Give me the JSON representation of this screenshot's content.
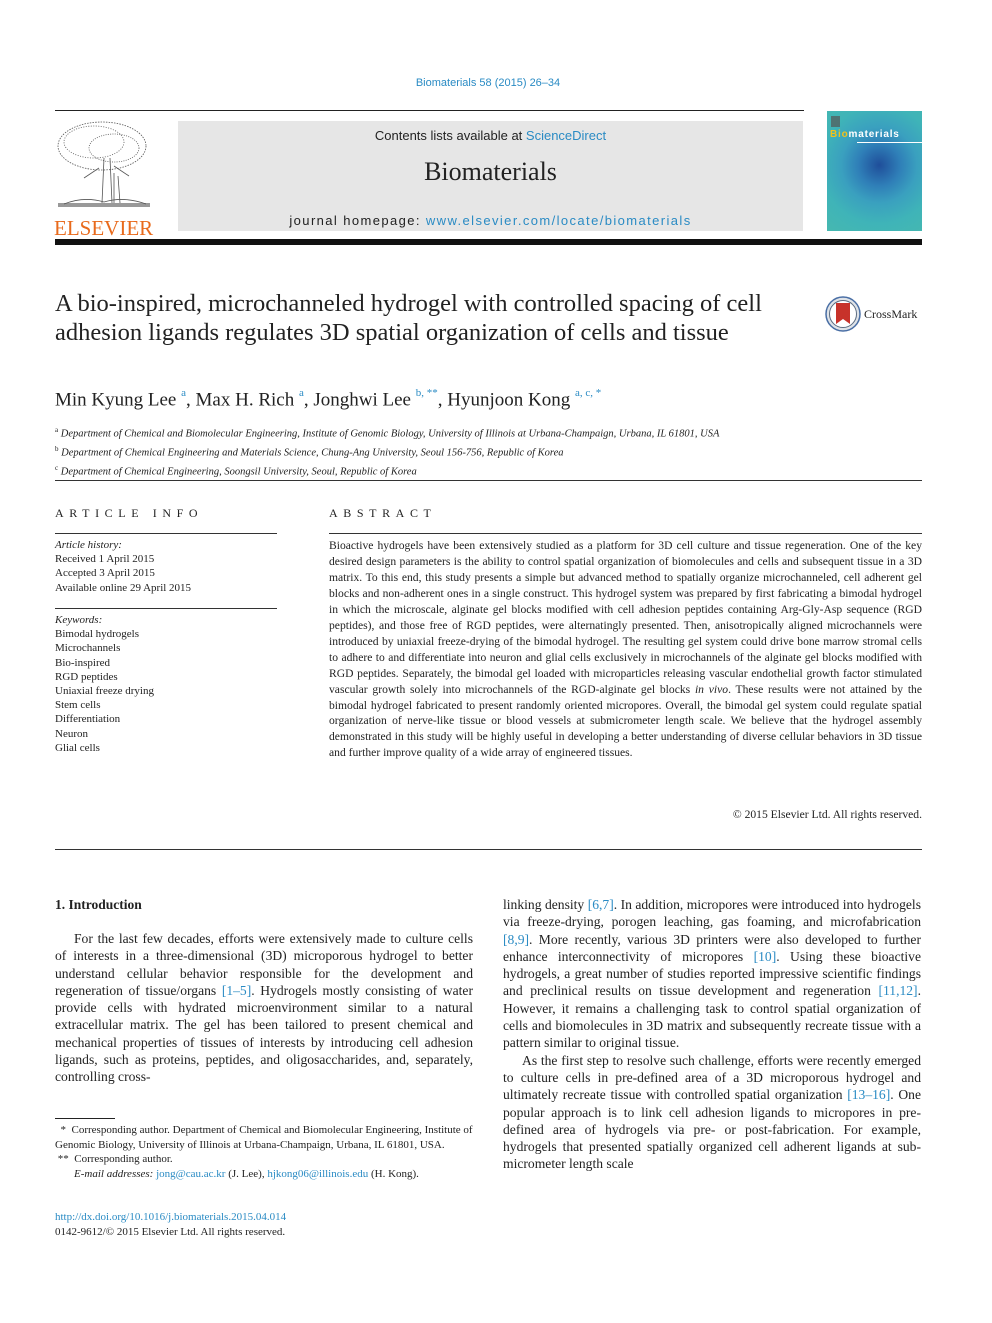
{
  "header": {
    "journal_ref": "Biomaterials 58 (2015) 26–34",
    "contents_prefix": "Contents lists available at ",
    "contents_link": "ScienceDirect",
    "journal_name": "Biomaterials",
    "homepage_prefix": "journal homepage: ",
    "homepage_link": "www.elsevier.com/locate/biomaterials",
    "publisher_logo_text": "ELSEVIER",
    "cover_title_bio": "Bio",
    "cover_title_rest": "materials",
    "crossmark_label": "CrossMark",
    "colors": {
      "link": "#2a8bc4",
      "elsevier_orange": "#e86a1c",
      "masthead_bg": "#e6e6e6"
    }
  },
  "article": {
    "title": "A bio-inspired, microchanneled hydrogel with controlled spacing of cell adhesion ligands regulates 3D spatial organization of cells and tissue",
    "authors": [
      {
        "name": "Min Kyung Lee",
        "sup": "a"
      },
      {
        "name": "Max H. Rich",
        "sup": "a"
      },
      {
        "name": "Jonghwi Lee",
        "sup": "b, **"
      },
      {
        "name": "Hyunjoon Kong",
        "sup": "a, c, *"
      }
    ],
    "affiliations": [
      {
        "mark": "a",
        "text": "Department of Chemical and Biomolecular Engineering, Institute of Genomic Biology, University of Illinois at Urbana-Champaign, Urbana, IL 61801, USA"
      },
      {
        "mark": "b",
        "text": "Department of Chemical Engineering and Materials Science, Chung-Ang University, Seoul 156-756, Republic of Korea"
      },
      {
        "mark": "c",
        "text": "Department of Chemical Engineering, Soongsil University, Seoul, Republic of Korea"
      }
    ]
  },
  "article_info": {
    "heading": "ARTICLE INFO",
    "history_label": "Article history:",
    "history": [
      "Received 1 April 2015",
      "Accepted 3 April 2015",
      "Available online 29 April 2015"
    ],
    "keywords_label": "Keywords:",
    "keywords": [
      "Bimodal hydrogels",
      "Microchannels",
      "Bio-inspired",
      "RGD peptides",
      "Uniaxial freeze drying",
      "Stem cells",
      "Differentiation",
      "Neuron",
      "Glial cells"
    ]
  },
  "abstract": {
    "heading": "ABSTRACT",
    "text_before_italic": "Bioactive hydrogels have been extensively studied as a platform for 3D cell culture and tissue regeneration. One of the key desired design parameters is the ability to control spatial organization of biomolecules and cells and subsequent tissue in a 3D matrix. To this end, this study presents a simple but advanced method to spatially organize microchanneled, cell adherent gel blocks and non-adherent ones in a single construct. This hydrogel system was prepared by first fabricating a bimodal hydrogel in which the microscale, alginate gel blocks modified with cell adhesion peptides containing Arg-Gly-Asp sequence (RGD peptides), and those free of RGD peptides, were alternatingly presented. Then, anisotropically aligned microchannels were introduced by uniaxial freeze-drying of the bimodal hydrogel. The resulting gel system could drive bone marrow stromal cells to adhere to and differentiate into neuron and glial cells exclusively in microchannels of the alginate gel blocks modified with RGD peptides. Separately, the bimodal gel loaded with microparticles releasing vascular endothelial growth factor stimulated vascular growth solely into microchannels of the RGD-alginate gel blocks ",
    "italic": "in vivo",
    "text_after_italic": ". These results were not attained by the bimodal hydrogel fabricated to present randomly oriented micropores. Overall, the bimodal gel system could regulate spatial organization of nerve-like tissue or blood vessels at submicrometer length scale. We believe that the hydrogel assembly demonstrated in this study will be highly useful in developing a better understanding of diverse cellular behaviors in 3D tissue and further improve quality of a wide array of engineered tissues.",
    "copyright": "© 2015 Elsevier Ltd. All rights reserved."
  },
  "introduction": {
    "heading": "1.  Introduction",
    "left_p1": [
      {
        "t": "For the last few decades, efforts were extensively made to culture cells of interests in a three-dimensional (3D) microporous hydrogel to better understand cellular behavior responsible for the development and regeneration of tissue/organs "
      },
      {
        "c": "[1–5]"
      },
      {
        "t": ". Hydrogels mostly consisting of water provide cells with hydrated microenvironment similar to a natural extracellular matrix. The gel has been tailored to present chemical and mechanical properties of tissues of interests by introducing cell adhesion ligands, such as proteins, peptides, and oligosaccharides, and, separately, controlling cross-"
      }
    ],
    "right_p1": [
      {
        "t": "linking density "
      },
      {
        "c": "[6,7]"
      },
      {
        "t": ". In addition, micropores were introduced into hydrogels via freeze-drying, porogen leaching, gas foaming, and microfabrication "
      },
      {
        "c": "[8,9]"
      },
      {
        "t": ". More recently, various 3D printers were also developed to further enhance interconnectivity of micropores "
      },
      {
        "c": "[10]"
      },
      {
        "t": ". Using these bioactive hydrogels, a great number of studies reported impressive scientific findings and preclinical results on tissue development and regeneration "
      },
      {
        "c": "[11,12]"
      },
      {
        "t": ". However, it remains a challenging task to control spatial organization of cells and biomolecules in 3D matrix and subsequently recreate tissue with a pattern similar to original tissue."
      }
    ],
    "right_p2": [
      {
        "t": "As the first step to resolve such challenge, efforts were recently emerged to culture cells in pre-defined area of a 3D microporous hydrogel and ultimately recreate tissue with controlled spatial organization "
      },
      {
        "c": "[13–16]"
      },
      {
        "t": ". One popular approach is to link cell adhesion ligands to micropores in pre-defined area of hydrogels via pre- or post-fabrication. For example, hydrogels that presented spatially organized cell adherent ligands at sub-micrometer length scale"
      }
    ]
  },
  "footnotes": {
    "star1_mark": "*",
    "star1_text": "Corresponding author. Department of Chemical and Biomolecular Engineering, Institute of Genomic Biology, University of Illinois at Urbana-Champaign, Urbana, IL 61801, USA.",
    "star2_mark": "**",
    "star2_text": "Corresponding author.",
    "email_label": "E-mail addresses:",
    "email1": "jong@cau.ac.kr",
    "email1_owner": " (J. Lee), ",
    "email2": "hjkong06@illinois.edu",
    "email2_owner": " (H. Kong).",
    "doi": "http://dx.doi.org/10.1016/j.biomaterials.2015.04.014",
    "issn_line": "0142-9612/© 2015 Elsevier Ltd. All rights reserved."
  }
}
